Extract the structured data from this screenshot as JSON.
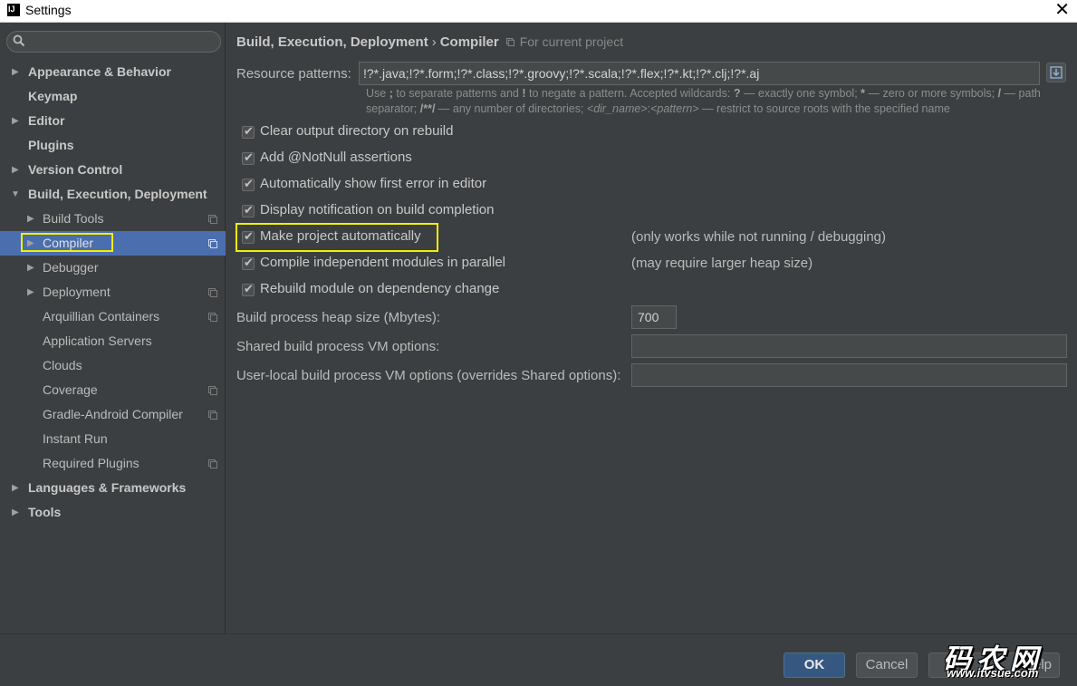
{
  "window": {
    "title": "Settings",
    "close_glyph": "✕"
  },
  "sidebar": {
    "items": [
      {
        "label": "Appearance & Behavior"
      },
      {
        "label": "Keymap"
      },
      {
        "label": "Editor"
      },
      {
        "label": "Plugins"
      },
      {
        "label": "Version Control"
      },
      {
        "label": "Build, Execution, Deployment"
      },
      {
        "label": "Build Tools"
      },
      {
        "label": "Compiler"
      },
      {
        "label": "Debugger"
      },
      {
        "label": "Deployment"
      },
      {
        "label": "Arquillian Containers"
      },
      {
        "label": "Application Servers"
      },
      {
        "label": "Clouds"
      },
      {
        "label": "Coverage"
      },
      {
        "label": "Gradle-Android Compiler"
      },
      {
        "label": "Instant Run"
      },
      {
        "label": "Required Plugins"
      },
      {
        "label": "Languages & Frameworks"
      },
      {
        "label": "Tools"
      }
    ]
  },
  "breadcrumb": {
    "part1": "Build, Execution, Deployment",
    "separator": "›",
    "part2": "Compiler",
    "scope": "For current project"
  },
  "compiler": {
    "resource_patterns_label": "Resource patterns:",
    "resource_patterns_value": "!?*.java;!?*.form;!?*.class;!?*.groovy;!?*.scala;!?*.flex;!?*.kt;!?*.clj;!?*.aj",
    "hint": {
      "t1": "Use ",
      "semicolon": ";",
      "t2": " to separate patterns and ",
      "bang": "!",
      "t3": " to negate a pattern. Accepted wildcards: ",
      "q": "?",
      "t4": " — exactly one symbol; ",
      "star": "*",
      "t5": " — zero or more symbols; ",
      "slash": "/",
      "t6": " — path separator; ",
      "dstar": "/**/",
      "t7": " — any number of directories; ",
      "dir": "<dir_name>",
      "colon": ":",
      "pattern": "<pattern>",
      "t8": " — restrict to source roots with the specified name"
    },
    "checkboxes": [
      {
        "label": "Clear output directory on rebuild"
      },
      {
        "label": "Add @NotNull assertions"
      },
      {
        "label": "Automatically show first error in editor"
      },
      {
        "label": "Display notification on build completion"
      },
      {
        "label": "Make project automatically"
      },
      {
        "label": "Compile independent modules in parallel"
      },
      {
        "label": "Rebuild module on dependency change"
      }
    ],
    "note_make": "(only works while not running / debugging)",
    "note_parallel": "(may require larger heap size)",
    "heap_label": "Build process heap size (Mbytes):",
    "heap_value": "700",
    "shared_vm_label": "Shared build process VM options:",
    "shared_vm_value": "",
    "user_vm_label": "User-local build process VM options (overrides Shared options):",
    "user_vm_value": ""
  },
  "buttons": {
    "ok": "OK",
    "cancel": "Cancel",
    "help": "Help"
  },
  "watermark": {
    "big": "码农网",
    "small": "www.itvsue.com"
  },
  "colors": {
    "selection": "#4b6eaf",
    "highlight": "#f0f000",
    "ok_button": "#365880"
  }
}
